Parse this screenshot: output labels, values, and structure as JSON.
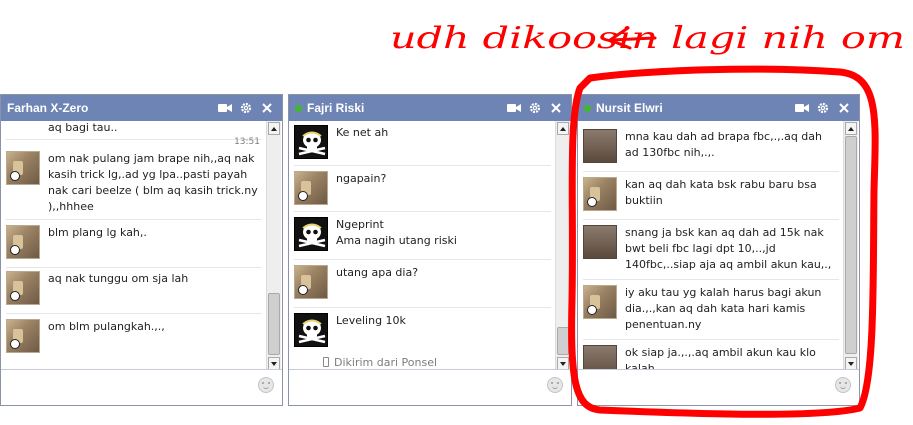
{
  "colors": {
    "header": "#6d84b4",
    "online": "#42b72a",
    "annotation": "#ff0000"
  },
  "annotation_text": "udh dikoosin lagi nih om",
  "chats": [
    {
      "name": "Farhan X-Zero",
      "icons": [
        "video-icon",
        "gear-icon",
        "close-icon"
      ],
      "scroll_note": "no-online-dot",
      "messages": [
        {
          "text": "aq bagi tau.."
        },
        {
          "timestamp": "13:51",
          "text": "om nak pulang jam brape nih,,aq nak kasih trick lg,.ad yg lpa..pasti payah nak cari beelze ( blm aq kasih trick.ny ),,hhhee"
        },
        {
          "text": "blm plang lg kah,."
        },
        {
          "text": "aq nak tunggu om sja lah"
        },
        {
          "text": "om blm pulangkah.,.,"
        }
      ]
    },
    {
      "name": "Fajri Riski",
      "icons": [
        "video-icon",
        "gear-icon",
        "close-icon"
      ],
      "messages": [
        {
          "text": "Ke net ah"
        },
        {
          "text": "ngapain?"
        },
        {
          "text": "Ngeprint"
        },
        {
          "text": "Ama nagih utang riski"
        },
        {
          "text": "utang apa dia?"
        },
        {
          "text": "Leveling 10k"
        },
        {
          "text": "Dikirim dari Ponsel"
        }
      ]
    },
    {
      "name": "Nursit Elwri",
      "icons": [
        "video-icon",
        "gear-icon",
        "close-icon"
      ],
      "messages": [
        {
          "text": "mna kau dah ad brapa fbc,.,.aq dah ad 130fbc nih,.,."
        },
        {
          "text": "kan aq dah kata bsk rabu baru bsa buktiin"
        },
        {
          "text": "snang ja bsk kan aq dah ad 15k nak bwt beli fbc lagi dpt 10,..,jd 140fbc,..siap aja aq ambil akun kau,.,"
        },
        {
          "text": "iy aku tau yg kalah harus bagi akun dia.,.,kan aq dah kata hari kamis penentuan.ny"
        },
        {
          "text": "ok siap ja.,.,.aq ambil akun kau klo kalah"
        }
      ]
    }
  ]
}
